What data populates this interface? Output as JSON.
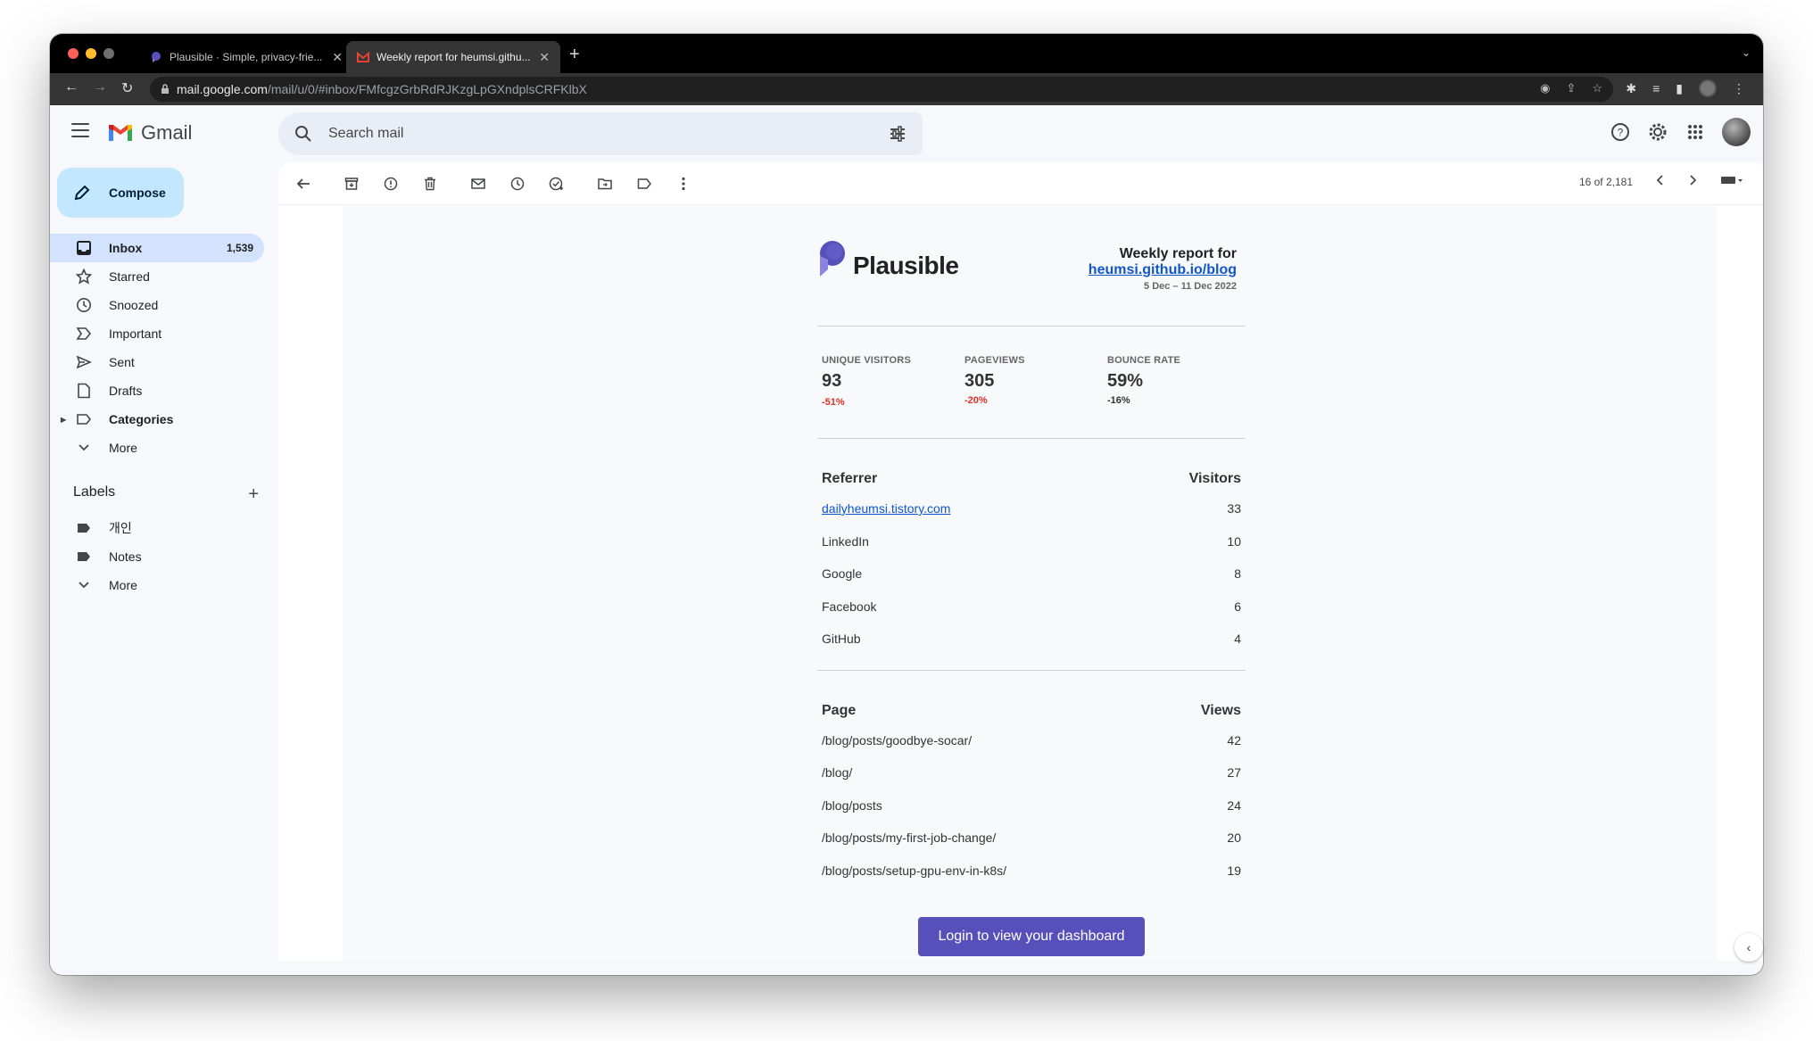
{
  "browser": {
    "tabs": [
      {
        "title": "Plausible · Simple, privacy-frie...",
        "active": false
      },
      {
        "title": "Weekly report for heumsi.githu...",
        "active": true
      }
    ],
    "url_host": "mail.google.com",
    "url_path": "/mail/u/0/#inbox/FMfcgzGrbRdRJKzgLpGXndplsCRFKlbX"
  },
  "gmail": {
    "logo_text": "Gmail",
    "search_placeholder": "Search mail",
    "compose_label": "Compose",
    "nav": [
      {
        "label": "Inbox",
        "count": "1,539",
        "icon": "inbox-icon"
      },
      {
        "label": "Starred",
        "count": "",
        "icon": "star-icon"
      },
      {
        "label": "Snoozed",
        "count": "",
        "icon": "clock-icon"
      },
      {
        "label": "Important",
        "count": "",
        "icon": "important-icon"
      },
      {
        "label": "Sent",
        "count": "",
        "icon": "send-icon"
      },
      {
        "label": "Drafts",
        "count": "",
        "icon": "draft-icon"
      },
      {
        "label": "Categories",
        "count": "",
        "icon": "label-icon"
      },
      {
        "label": "More",
        "count": "",
        "icon": "chevron-down-icon"
      }
    ],
    "labels_title": "Labels",
    "labels": [
      {
        "label": "개인"
      },
      {
        "label": "Notes"
      },
      {
        "label": "More"
      }
    ],
    "pagination": "16 of 2,181"
  },
  "report": {
    "brand": "Plausible",
    "title_line": "Weekly report for",
    "site": "heumsi.github.io/blog",
    "date_range": "5 Dec – 11 Dec 2022",
    "stats": [
      {
        "label": "UNIQUE VISITORS",
        "value": "93",
        "change": "-51%",
        "color": "#d93025"
      },
      {
        "label": "PAGEVIEWS",
        "value": "305",
        "change": "-20%",
        "color": "#d93025"
      },
      {
        "label": "BOUNCE RATE",
        "value": "59%",
        "change": "-16%",
        "color": "#333333"
      }
    ],
    "referrers": {
      "header_left": "Referrer",
      "header_right": "Visitors",
      "rows": [
        {
          "name": "dailyheumsi.tistory.com",
          "value": "33"
        },
        {
          "name": "LinkedIn",
          "value": "10"
        },
        {
          "name": "Google",
          "value": "8"
        },
        {
          "name": "Facebook",
          "value": "6"
        },
        {
          "name": "GitHub",
          "value": "4"
        }
      ]
    },
    "pages": {
      "header_left": "Page",
      "header_right": "Views",
      "rows": [
        {
          "name": "/blog/posts/goodbye-socar/",
          "value": "42"
        },
        {
          "name": "/blog/",
          "value": "27"
        },
        {
          "name": "/blog/posts",
          "value": "24"
        },
        {
          "name": "/blog/posts/my-first-job-change/",
          "value": "20"
        },
        {
          "name": "/blog/posts/setup-gpu-env-in-k8s/",
          "value": "19"
        }
      ]
    },
    "cta": "Login to view your dashboard"
  },
  "colors": {
    "plausible_brand": "#5850ba",
    "link": "#1155cc",
    "negative": "#d93025",
    "inbox_active": "#d3e3fd",
    "compose_bg": "#c2e7ff"
  }
}
